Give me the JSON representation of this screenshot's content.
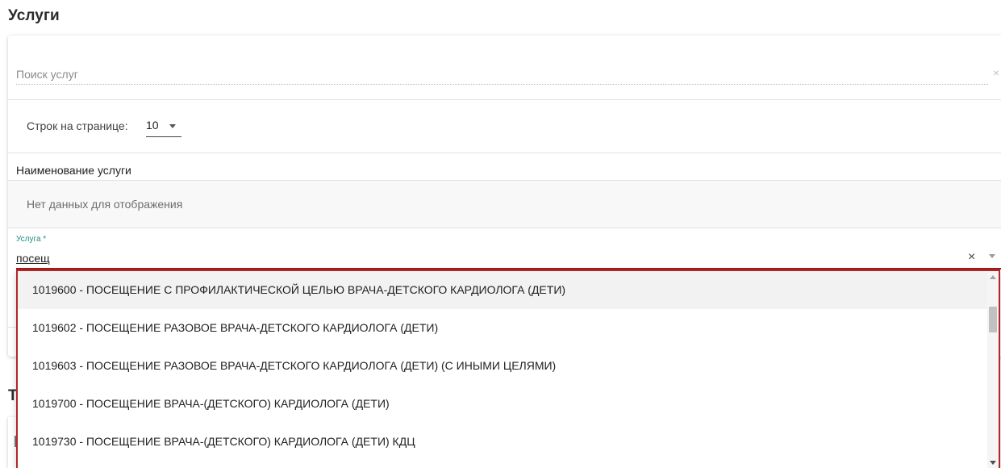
{
  "section": {
    "title": "Услуги"
  },
  "search": {
    "placeholder": "Поиск услуг",
    "clear_icon": "×"
  },
  "pagination": {
    "rows_label": "Строк на странице:",
    "rows_value": "10"
  },
  "table": {
    "column_header": "Наименование услуги",
    "empty_text": "Нет данных для отображения"
  },
  "service_field": {
    "label": "Услуга *",
    "value": "посещ",
    "clear_icon": "×",
    "accent_color": "#1e8c7e",
    "error_color": "#b3262a"
  },
  "dropdown": {
    "items": [
      "1019600 - ПОСЕЩЕНИЕ С ПРОФИЛАКТИЧЕСКОЙ ЦЕЛЬЮ ВРАЧА-ДЕТСКОГО КАРДИОЛОГА (ДЕТИ)",
      "1019602 - ПОСЕЩЕНИЕ РАЗОВОЕ ВРАЧА-ДЕТСКОГО КАРДИОЛОГА (ДЕТИ)",
      "1019603 - ПОСЕЩЕНИЕ РАЗОВОЕ ВРАЧА-ДЕТСКОГО КАРДИОЛОГА (ДЕТИ) (С ИНЫМИ ЦЕЛЯМИ)",
      "1019700 - ПОСЕЩЕНИЕ ВРАЧА-(ДЕТСКОГО) КАРДИОЛОГА (ДЕТИ)",
      "1019730 - ПОСЕЩЕНИЕ ВРАЧА-(ДЕТСКОГО) КАРДИОЛОГА (ДЕТИ) КДЦ"
    ]
  },
  "next_section": {
    "title_fragment": "Т"
  }
}
